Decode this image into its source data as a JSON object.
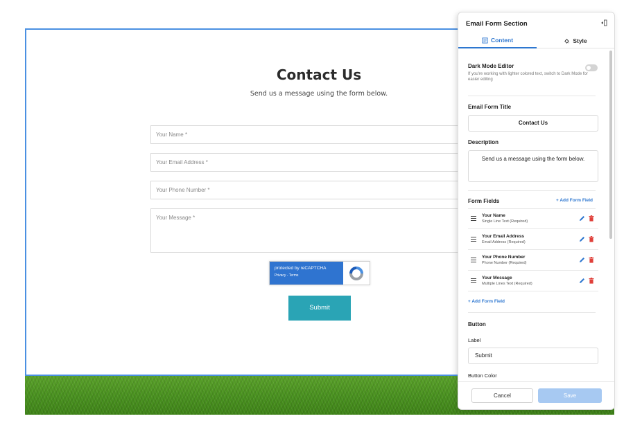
{
  "preview": {
    "title": "Contact Us",
    "description": "Send us a message using the form below.",
    "fields": {
      "name": "Your Name *",
      "email": "Your Email Address *",
      "phone": "Your Phone Number *",
      "message": "Your Message *"
    },
    "recaptcha": {
      "line1": "protected by reCAPTCHA",
      "line2": "Privacy - Terms"
    },
    "submit_label": "Submit"
  },
  "panel": {
    "title": "Email Form Section",
    "tabs": {
      "content": "Content",
      "style": "Style"
    },
    "dark_mode": {
      "label": "Dark Mode Editor",
      "help": "If you're working with lighter colored text, switch to Dark Mode for easier editing",
      "enabled": false
    },
    "form_title": {
      "label": "Email Form Title",
      "value": "Contact Us"
    },
    "description": {
      "label": "Description",
      "value": "Send us a message using the form below."
    },
    "form_fields": {
      "label": "Form Fields",
      "add_link": "+ Add Form Field",
      "items": [
        {
          "name": "Your Name",
          "type": "Single Line Text (Required)"
        },
        {
          "name": "Your Email Address",
          "type": "Email Address (Required)"
        },
        {
          "name": "Your Phone Number",
          "type": "Phone Number (Required)"
        },
        {
          "name": "Your Message",
          "type": "Multiple Lines Text (Required)"
        }
      ],
      "add_link_bottom": "+ Add Form Field"
    },
    "button": {
      "section": "Button",
      "label_caption": "Label",
      "label_value": "Submit",
      "color_caption": "Button Color"
    },
    "footer": {
      "cancel": "Cancel",
      "save": "Save"
    }
  },
  "colors": {
    "accent": "#2e77d0",
    "submit": "#2aa4b5",
    "save_disabled": "#a7c9f2",
    "delete": "#e0403a",
    "preview_border": "#4a90e2"
  }
}
